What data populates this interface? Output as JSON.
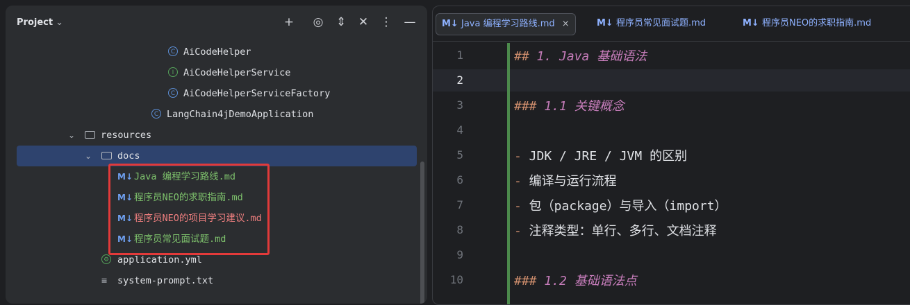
{
  "project": {
    "title": "Project",
    "tree": [
      {
        "label": "AiCodeHelper",
        "kind": "class"
      },
      {
        "label": "AiCodeHelperService",
        "kind": "interface"
      },
      {
        "label": "AiCodeHelperServiceFactory",
        "kind": "class"
      },
      {
        "label": "LangChain4jDemoApplication",
        "kind": "app"
      },
      {
        "label": "resources",
        "kind": "folder"
      },
      {
        "label": "docs",
        "kind": "folder"
      },
      {
        "label": "Java 编程学习路线.md",
        "kind": "md"
      },
      {
        "label": "程序员NEO的求职指南.md",
        "kind": "md"
      },
      {
        "label": "程序员NEO的项目学习建议.md",
        "kind": "md"
      },
      {
        "label": "程序员常见面试题.md",
        "kind": "md"
      },
      {
        "label": "application.yml",
        "kind": "yml"
      },
      {
        "label": "system-prompt.txt",
        "kind": "txt"
      }
    ],
    "md_icon": "M↓"
  },
  "editor": {
    "tabs": [
      {
        "label": "Java 编程学习路线.md",
        "active": true
      },
      {
        "label": "程序员常见面试题.md",
        "active": false
      },
      {
        "label": "程序员NEO的求职指南.md",
        "active": false
      }
    ],
    "lines": [
      {
        "num": "1",
        "hash": "##",
        "text": " 1. Java 基础语法"
      },
      {
        "num": "2",
        "hash": "",
        "text": ""
      },
      {
        "num": "3",
        "hash": "###",
        "text": " 1.1 关键概念"
      },
      {
        "num": "4",
        "hash": "",
        "text": ""
      },
      {
        "num": "5",
        "bullet": "-",
        "text": " JDK / JRE / JVM 的区别"
      },
      {
        "num": "6",
        "bullet": "-",
        "text": " 编译与运行流程"
      },
      {
        "num": "7",
        "bullet": "-",
        "text": " 包（package）与导入（import）"
      },
      {
        "num": "8",
        "bullet": "-",
        "text": " 注释类型：单行、多行、文档注释"
      },
      {
        "num": "9",
        "hash": "",
        "text": ""
      },
      {
        "num": "10",
        "hash": "###",
        "text": " 1.2 基础语法点"
      }
    ]
  }
}
